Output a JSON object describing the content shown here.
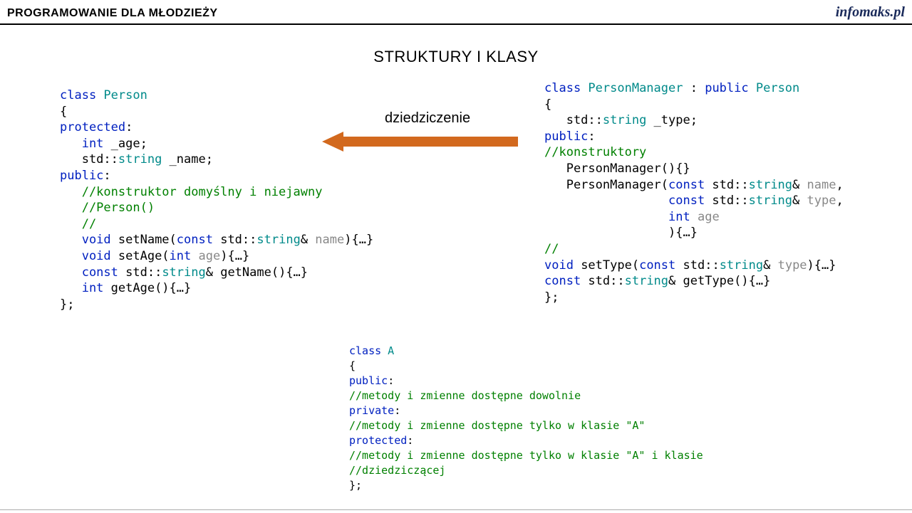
{
  "header": {
    "left": "PROGRAMOWANIE DLA MŁODZIEŻY",
    "right": "infomaks.pl"
  },
  "title": "STRUKTURY I KLASY",
  "arrow_label": "dziedziczenie",
  "code_left": {
    "l1_kw": "class",
    "l1_type": " Person",
    "l2": "{",
    "l3_kw": "protected",
    "l3_colon": ":",
    "l4_kw": "   int",
    "l4_rest": " _age;",
    "l5a": "   std::",
    "l5_type": "string",
    "l5b": " _name;",
    "l6_kw": "public",
    "l6_colon": ":",
    "l7_cmt": "   //konstruktor domyślny i niejawny",
    "l8_cmt": "   //Person()",
    "l9_cmt": "   //",
    "l10_kw": "   void",
    "l10a": " setName(",
    "l10_kw2": "const",
    "l10b": " std::",
    "l10_type": "string",
    "l10c": "& ",
    "l10_arg": "name",
    "l10d": "){…}",
    "l11_kw": "   void",
    "l11a": " setAge(",
    "l11_kw2": "int",
    "l11b": " ",
    "l11_arg": "age",
    "l11c": "){…}",
    "l12_kw": "   const",
    "l12a": " std::",
    "l12_type": "string",
    "l12b": "& getName(){…}",
    "l13_kw": "   int",
    "l13a": " getAge(){…}",
    "l14": "};"
  },
  "code_right": {
    "l1_kw": "class",
    "l1_type": " PersonManager",
    "l1a": " : ",
    "l1_kw2": "public",
    "l1_type2": " Person",
    "l2": "{",
    "l3a": "   std::",
    "l3_type": "string",
    "l3b": " _type;",
    "l4_kw": "public",
    "l4_colon": ":",
    "l5_cmt": "//konstruktory",
    "l6": "   PersonManager(){}",
    "l7a": "   PersonManager(",
    "l7_kw": "const",
    "l7b": " std::",
    "l7_type": "string",
    "l7c": "& ",
    "l7_arg": "name",
    "l7d": ",",
    "l8a": "                 ",
    "l8_kw": "const",
    "l8b": " std::",
    "l8_type": "string",
    "l8c": "& ",
    "l8_arg": "type",
    "l8d": ",",
    "l9a": "                 ",
    "l9_kw": "int",
    "l9b": " ",
    "l9_arg": "age",
    "l10": "                 ){…}",
    "l11_cmt": "//",
    "l12_kw": "void",
    "l12a": " setType(",
    "l12_kw2": "const",
    "l12b": " std::",
    "l12_type": "string",
    "l12c": "& ",
    "l12_arg": "type",
    "l12d": "){…}",
    "l13_kw": "const",
    "l13a": " std::",
    "l13_type": "string",
    "l13b": "& getType(){…}",
    "l14": "};"
  },
  "code_bottom": {
    "l1_kw": "class",
    "l1_type": " A",
    "l2": "{",
    "l3_kw": "public",
    "l3_colon": ":",
    "l4_cmt": "//metody i zmienne dostępne dowolnie",
    "l5_kw": "private",
    "l5_colon": ":",
    "l6_cmt": "//metody i zmienne dostępne tylko w klasie \"A\"",
    "l7_kw": "protected",
    "l7_colon": ":",
    "l8_cmt": "//metody i zmienne dostępne tylko w klasie \"A\" i klasie",
    "l9_cmt": "//dziedziczącej",
    "l10": "};"
  }
}
